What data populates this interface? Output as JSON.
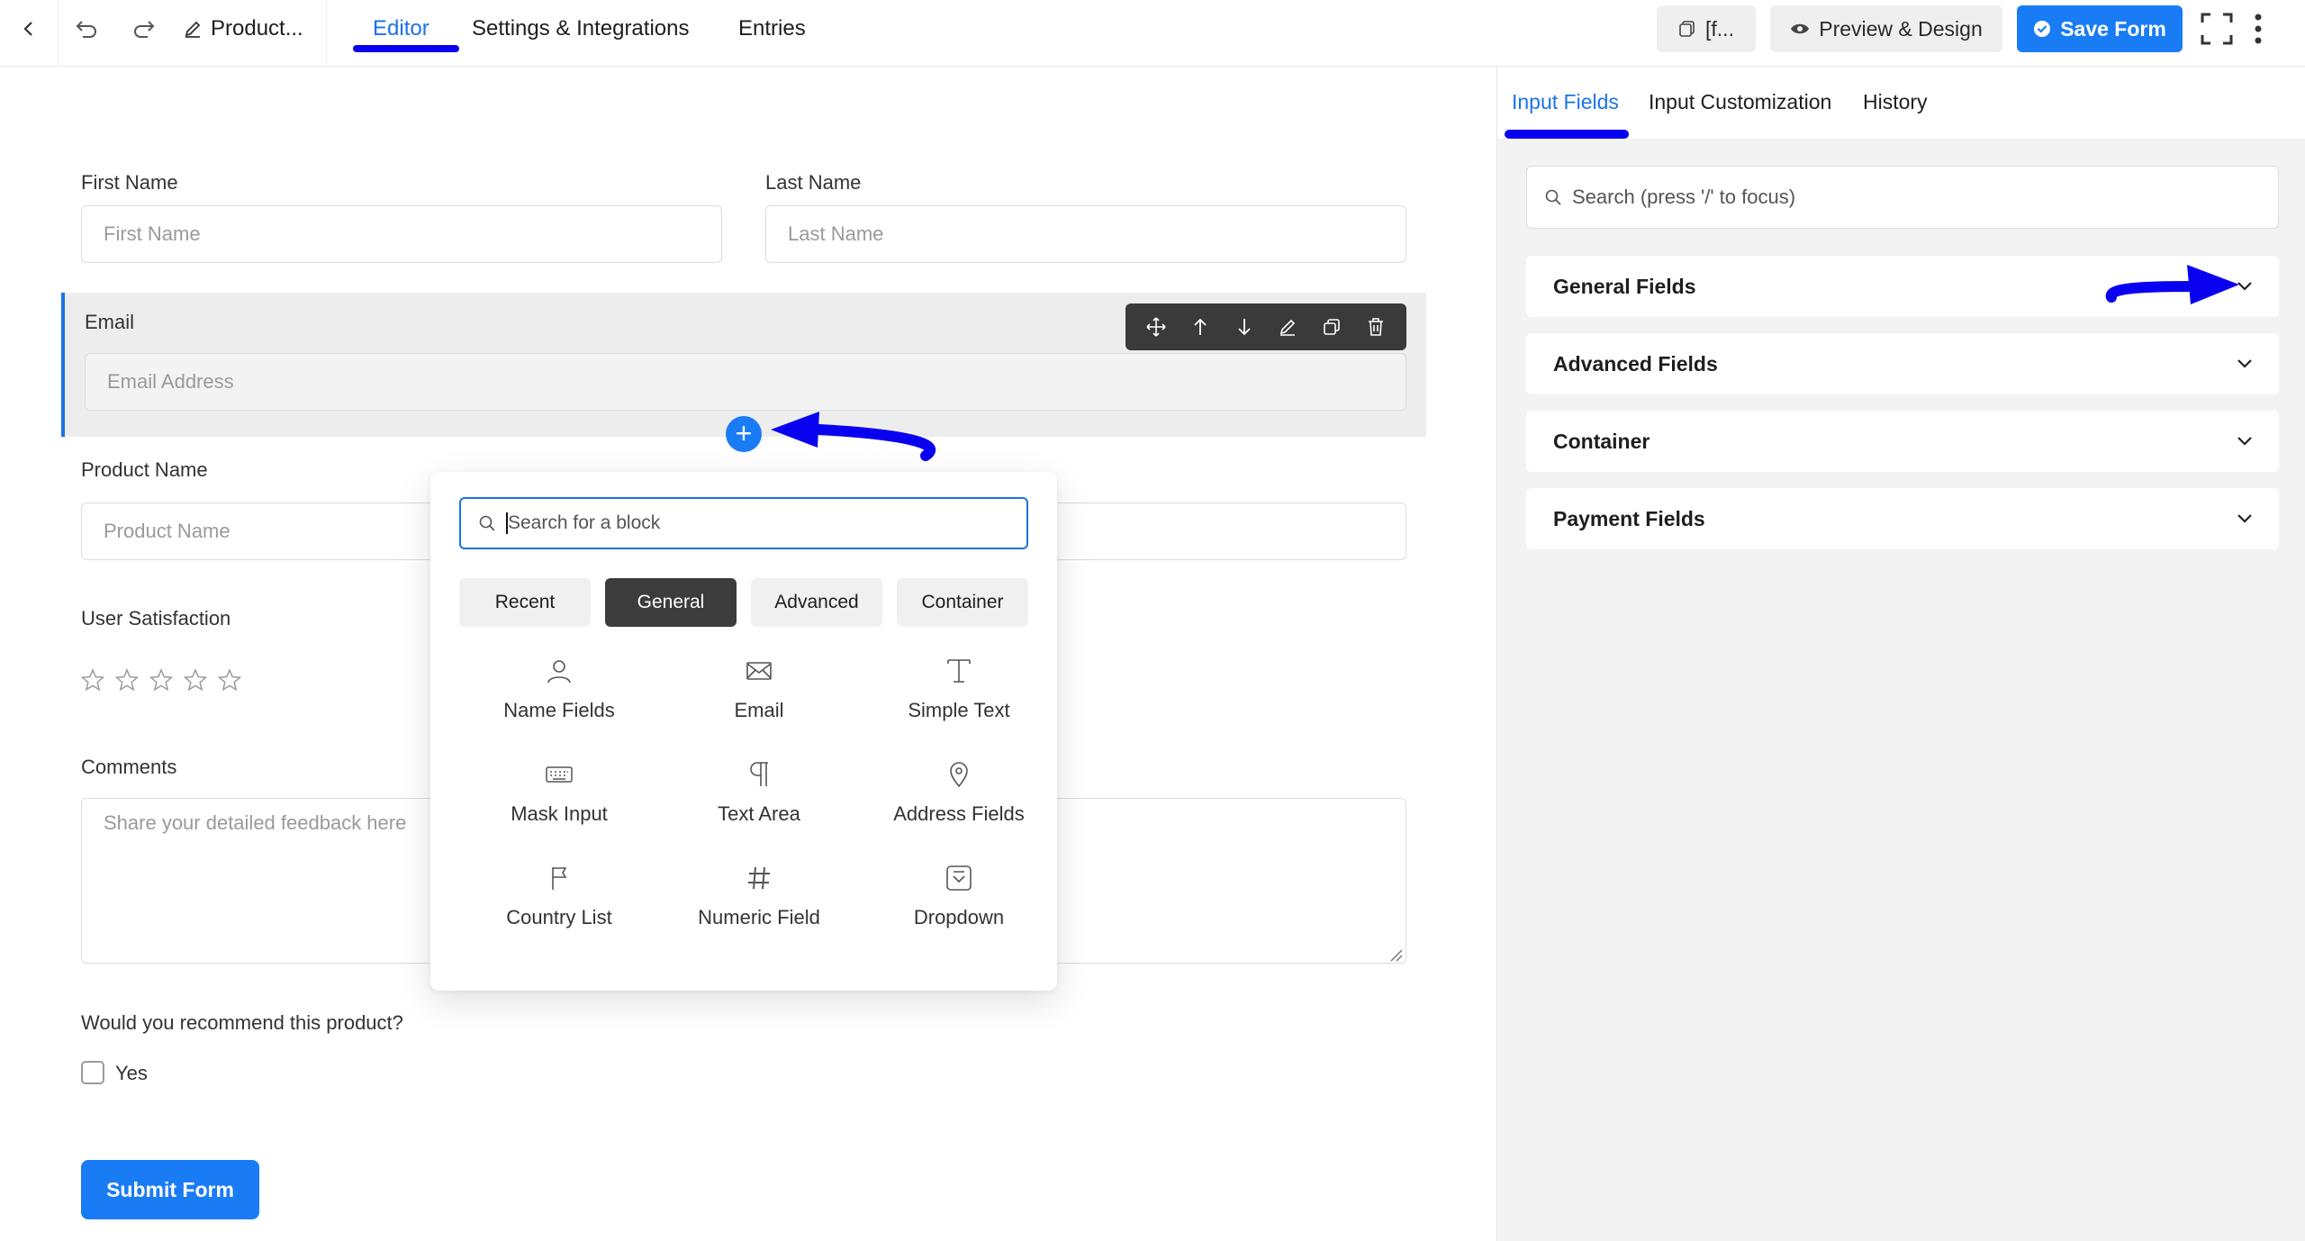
{
  "topbar": {
    "form_title": "Product...",
    "tabs": [
      {
        "label": "Editor"
      },
      {
        "label": "Settings & Integrations"
      },
      {
        "label": "Entries"
      }
    ],
    "shortcode_label": "[f...",
    "preview_label": "Preview & Design",
    "save_label": "Save Form"
  },
  "form": {
    "first_name": {
      "label": "First Name",
      "placeholder": "First Name"
    },
    "last_name": {
      "label": "Last Name",
      "placeholder": "Last Name"
    },
    "email": {
      "label": "Email",
      "placeholder": "Email Address"
    },
    "product_name": {
      "label": "Product Name",
      "placeholder": "Product Name"
    },
    "satisfaction": {
      "label": "User Satisfaction",
      "rating_max": 5,
      "rating_value": 0
    },
    "comments": {
      "label": "Comments",
      "placeholder": "Share your detailed feedback here"
    },
    "recommend": {
      "label": "Would you recommend this product?",
      "option": "Yes"
    },
    "submit_label": "Submit Form"
  },
  "block_picker": {
    "search_placeholder": "Search for a block",
    "categories": [
      {
        "label": "Recent"
      },
      {
        "label": "General"
      },
      {
        "label": "Advanced"
      },
      {
        "label": "Container"
      }
    ],
    "active_category": "General",
    "blocks": [
      {
        "label": "Name Fields",
        "icon": "user-icon"
      },
      {
        "label": "Email",
        "icon": "envelope-icon"
      },
      {
        "label": "Simple Text",
        "icon": "text-cursor-icon"
      },
      {
        "label": "Mask Input",
        "icon": "keyboard-icon"
      },
      {
        "label": "Text Area",
        "icon": "pilcrow-icon"
      },
      {
        "label": "Address Fields",
        "icon": "map-pin-icon"
      },
      {
        "label": "Country List",
        "icon": "flag-icon"
      },
      {
        "label": "Numeric Field",
        "icon": "hash-icon"
      },
      {
        "label": "Dropdown",
        "icon": "dropdown-icon"
      }
    ]
  },
  "sidebar": {
    "tabs": [
      {
        "label": "Input Fields"
      },
      {
        "label": "Input Customization"
      },
      {
        "label": "History"
      }
    ],
    "search_placeholder": "Search (press '/' to focus)",
    "sections": [
      {
        "label": "General Fields"
      },
      {
        "label": "Advanced Fields"
      },
      {
        "label": "Container"
      },
      {
        "label": "Payment Fields"
      }
    ]
  },
  "colors": {
    "accent": "#1a73e8",
    "primary_button": "#1a7cf5",
    "annotation_arrow": "#0a00f0"
  }
}
